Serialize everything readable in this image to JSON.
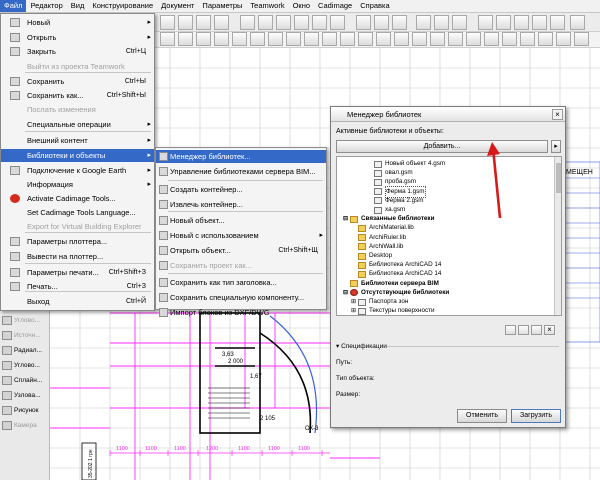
{
  "menubar": {
    "items": [
      "Файл",
      "Редактор",
      "Вид",
      "Конструирование",
      "Документ",
      "Параметры",
      "Teamwork",
      "Окно",
      "Cadimage",
      "Справка"
    ]
  },
  "file_menu": {
    "items": [
      {
        "label": "Новый",
        "shortcut": "",
        "submenu": true,
        "dim": false
      },
      {
        "label": "Открыть",
        "shortcut": "",
        "submenu": true,
        "dim": false
      },
      {
        "label": "Закрыть",
        "shortcut": "Ctrl+Ц",
        "submenu": false,
        "dim": false
      },
      {
        "label": "Выйти из проекта Teamwork",
        "shortcut": "",
        "submenu": false,
        "dim": true
      },
      {
        "label": "Сохранить",
        "shortcut": "Ctrl+Ы",
        "submenu": false,
        "dim": false
      },
      {
        "label": "Сохранить как...",
        "shortcut": "Ctrl+Shift+Ы",
        "submenu": false,
        "dim": false
      },
      {
        "label": "Послать изменения",
        "shortcut": "",
        "submenu": false,
        "dim": true
      },
      {
        "label": "Специальные операции",
        "shortcut": "",
        "submenu": true,
        "dim": false
      },
      {
        "label": "Внешний контент",
        "shortcut": "",
        "submenu": true,
        "dim": false
      },
      {
        "label": "Библиотеки и объекты",
        "shortcut": "",
        "submenu": true,
        "dim": false
      },
      {
        "label": "Подключение к Google Earth",
        "shortcut": "",
        "submenu": true,
        "dim": false
      },
      {
        "label": "Информация",
        "shortcut": "",
        "submenu": true,
        "dim": false
      },
      {
        "label": "Activate Cadimage Tools...",
        "shortcut": "",
        "submenu": false,
        "dim": false
      },
      {
        "label": "Set Cadimage Tools Language...",
        "shortcut": "",
        "submenu": false,
        "dim": false
      },
      {
        "label": "Export for Virtual Building Explorer",
        "shortcut": "",
        "submenu": false,
        "dim": true
      },
      {
        "label": "Параметры плоттера...",
        "shortcut": "",
        "submenu": false,
        "dim": false
      },
      {
        "label": "Вывести на плоттер...",
        "shortcut": "",
        "submenu": false,
        "dim": false
      },
      {
        "label": "Параметры печати...",
        "shortcut": "Ctrl+Shift+З",
        "submenu": false,
        "dim": false
      },
      {
        "label": "Печать...",
        "shortcut": "Ctrl+З",
        "submenu": false,
        "dim": false
      },
      {
        "label": "Выход",
        "shortcut": "Ctrl+Й",
        "submenu": false,
        "dim": false
      }
    ]
  },
  "sub_menu": {
    "items": [
      {
        "label": "Менеджер библиотек...",
        "shortcut": "",
        "submenu": false,
        "dim": false
      },
      {
        "label": "Управление библиотеками сервера BIM...",
        "shortcut": "",
        "submenu": false,
        "dim": false
      },
      {
        "label": "Создать контейнер...",
        "shortcut": "",
        "submenu": false,
        "dim": false
      },
      {
        "label": "Извлечь контейнер...",
        "shortcut": "",
        "submenu": false,
        "dim": false
      },
      {
        "label": "Новый объект...",
        "shortcut": "",
        "submenu": false,
        "dim": false
      },
      {
        "label": "Новый с использованием",
        "shortcut": "",
        "submenu": true,
        "dim": false
      },
      {
        "label": "Открыть объект...",
        "shortcut": "Ctrl+Shift+Щ",
        "submenu": false,
        "dim": false
      },
      {
        "label": "Сохранить проект как...",
        "shortcut": "",
        "submenu": false,
        "dim": true
      },
      {
        "label": "Сохранить как тип заголовка...",
        "shortcut": "",
        "submenu": false,
        "dim": false
      },
      {
        "label": "Сохранить специальную компоненту...",
        "shortcut": "",
        "submenu": false,
        "dim": false
      },
      {
        "label": "Импорт блоков из DXF/DWG",
        "shortcut": "",
        "submenu": false,
        "dim": false
      }
    ]
  },
  "palette": {
    "items": [
      "Угловo...",
      "Источн...",
      "Радиал...",
      "Углово...",
      "Сплайн...",
      "Узлова...",
      "Рисунок",
      "Камера"
    ]
  },
  "dialog": {
    "title": "Менеджер библиотек",
    "close_label": "×",
    "active_libs_label": "Активные библиотеки и объекты:",
    "add_button": "Добавить...",
    "add_arrow": "▸",
    "tree": [
      {
        "label": "Новый объект 4.gsm",
        "indent": 3,
        "icon": "file",
        "bold": false,
        "expand": "",
        "highlight": false
      },
      {
        "label": "овал.gsm",
        "indent": 3,
        "icon": "file",
        "bold": false,
        "expand": "",
        "highlight": false
      },
      {
        "label": "проба.gsm",
        "indent": 3,
        "icon": "file",
        "bold": false,
        "expand": "",
        "highlight": false
      },
      {
        "label": "Ферма 1.gsm",
        "indent": 3,
        "icon": "file",
        "bold": false,
        "expand": "",
        "highlight": true
      },
      {
        "label": "Ферма 2.gsm",
        "indent": 3,
        "icon": "file",
        "bold": false,
        "expand": "",
        "highlight": false
      },
      {
        "label": "ха.gsm",
        "indent": 3,
        "icon": "file",
        "bold": false,
        "expand": "",
        "highlight": false
      },
      {
        "label": "Связанные библиотеки",
        "indent": 0,
        "icon": "folder",
        "bold": true,
        "expand": "⊟",
        "highlight": false
      },
      {
        "label": "ArchiMaterial.lib",
        "indent": 1,
        "icon": "folder",
        "bold": false,
        "expand": "",
        "highlight": false
      },
      {
        "label": "ArchiRuler.lib",
        "indent": 1,
        "icon": "folder",
        "bold": false,
        "expand": "",
        "highlight": false
      },
      {
        "label": "ArchiWall.lib",
        "indent": 1,
        "icon": "folder",
        "bold": false,
        "expand": "",
        "highlight": false
      },
      {
        "label": "Desktop",
        "indent": 1,
        "icon": "folder",
        "bold": false,
        "expand": "",
        "highlight": false
      },
      {
        "label": "Библиотека ArchiCAD 14",
        "indent": 1,
        "icon": "folder",
        "bold": false,
        "expand": "",
        "highlight": false
      },
      {
        "label": "Библиотека ArchiCAD 14",
        "indent": 1,
        "icon": "folder",
        "bold": false,
        "expand": "",
        "highlight": false
      },
      {
        "label": "Библиотеки сервера BIM",
        "indent": 0,
        "icon": "folder",
        "bold": true,
        "expand": "",
        "highlight": false
      },
      {
        "label": "Отсутствующие библиотеки",
        "indent": 0,
        "icon": "err",
        "bold": true,
        "expand": "⊟",
        "highlight": false
      },
      {
        "label": "Паспорта зон",
        "indent": 1,
        "icon": "file",
        "bold": false,
        "expand": "⊞",
        "highlight": false
      },
      {
        "label": "Текстуры поверхности",
        "indent": 1,
        "icon": "file",
        "bold": false,
        "expand": "⊞",
        "highlight": false
      }
    ],
    "spec_label": "Спецификации",
    "spec_arrow": "▾",
    "paths_label": "Путь:",
    "type_label": "Тип объекта:",
    "size_label": "Размер:",
    "cancel_button": "Отменить",
    "load_button": "Загрузить"
  },
  "canvas": {
    "dims_bottom": [
      "1100",
      "1100",
      "1100",
      "1200",
      "1100",
      "1100",
      "1100"
    ],
    "room_labels": [
      "3,63",
      "2 000",
      "1,67",
      "2 105",
      "ОК-3"
    ],
    "right_header": "МЕЩЕН",
    "left_vertical": "35-202 1 грн"
  },
  "colors": {
    "accent": "#3569c8",
    "magenta": "#ff2bff",
    "annotation": "#d61a1a"
  }
}
